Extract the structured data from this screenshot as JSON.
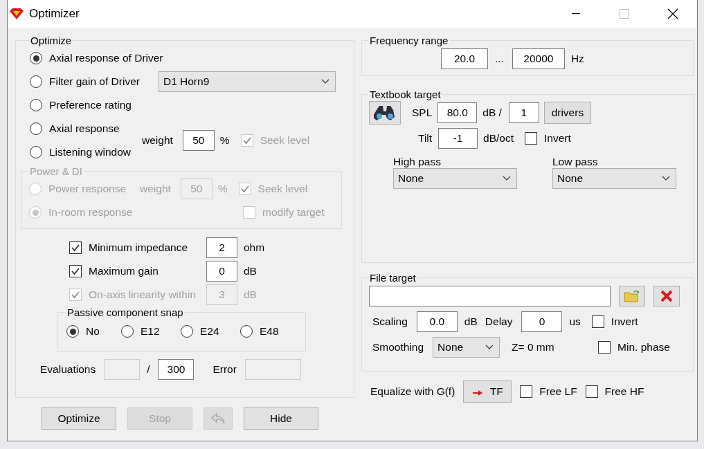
{
  "window": {
    "title": "Optimizer"
  },
  "optimize": {
    "title": "Optimize",
    "targets": [
      {
        "label": "Axial response of Driver",
        "selected": true
      },
      {
        "label": "Filter gain of Driver",
        "selected": false
      },
      {
        "label": "Preference rating",
        "selected": false
      },
      {
        "label": "Axial response",
        "selected": false
      },
      {
        "label": "Listening window",
        "selected": false
      }
    ],
    "driver_select": {
      "value": "D1 Horn9"
    },
    "weight": {
      "label": "weight",
      "value": "50",
      "unit": "%"
    },
    "seek_level": {
      "label": "Seek level",
      "checked": true,
      "disabled": true
    },
    "power_di": {
      "title": "Power & DI",
      "disabled": true,
      "options": [
        {
          "label": "Power response",
          "selected": false
        },
        {
          "label": "In-room response",
          "selected": true
        }
      ],
      "weight": {
        "label": "weight",
        "value": "50",
        "unit": "%"
      },
      "seek_level": {
        "label": "Seek level",
        "checked": true
      },
      "modify_target": {
        "label": "modify target",
        "checked": false
      }
    },
    "constraints": [
      {
        "label": "Minimum impedance",
        "checked": true,
        "disabled": false,
        "value": "2",
        "unit": "ohm"
      },
      {
        "label": "Maximum gain",
        "checked": true,
        "disabled": false,
        "value": "0",
        "unit": "dB"
      },
      {
        "label": "On-axis linearity within",
        "checked": true,
        "disabled": true,
        "value": "3",
        "unit": "dB"
      }
    ],
    "snap": {
      "title": "Passive component snap",
      "options": [
        {
          "label": "No",
          "selected": true
        },
        {
          "label": "E12",
          "selected": false
        },
        {
          "label": "E24",
          "selected": false
        },
        {
          "label": "E48",
          "selected": false
        }
      ]
    },
    "evaluations": {
      "label": "Evaluations",
      "separator": "/",
      "max": "300"
    },
    "error": {
      "label": "Error"
    }
  },
  "buttons": [
    {
      "kind": "text",
      "label": "Optimize",
      "disabled": false
    },
    {
      "kind": "text",
      "label": "Stop",
      "disabled": true
    },
    {
      "kind": "undo",
      "disabled": true
    },
    {
      "kind": "text",
      "label": "Hide",
      "disabled": false
    }
  ],
  "frequency_range": {
    "title": "Frequency range",
    "from": "20.0",
    "separator": "...",
    "to": "20000",
    "unit": "Hz"
  },
  "textbook_target": {
    "title": "Textbook target",
    "spl_label": "SPL",
    "spl": "80.0",
    "spl_unit": "dB /",
    "driver_count": "1",
    "drivers_button": "drivers",
    "tilt_label": "Tilt",
    "tilt": "-1",
    "tilt_unit": "dB/oct",
    "invert": {
      "label": "Invert",
      "checked": false
    },
    "high_pass": {
      "label": "High pass",
      "value": "None"
    },
    "low_pass": {
      "label": "Low pass",
      "value": "None"
    }
  },
  "file_target": {
    "title": "File target",
    "scaling_label": "Scaling",
    "scaling": "0.0",
    "scaling_unit": "dB",
    "delay_label": "Delay",
    "delay": "0",
    "delay_unit": "us",
    "invert": {
      "label": "Invert",
      "checked": false
    },
    "smoothing_label": "Smoothing",
    "smoothing": "None",
    "z": "Z= 0 mm",
    "min_phase": {
      "label": "Min. phase",
      "checked": false
    }
  },
  "equalize": {
    "label": "Equalize with G(f)",
    "button": "TF",
    "free_lf": {
      "label": "Free LF",
      "checked": false
    },
    "free_hf": {
      "label": "Free HF",
      "checked": false
    }
  }
}
